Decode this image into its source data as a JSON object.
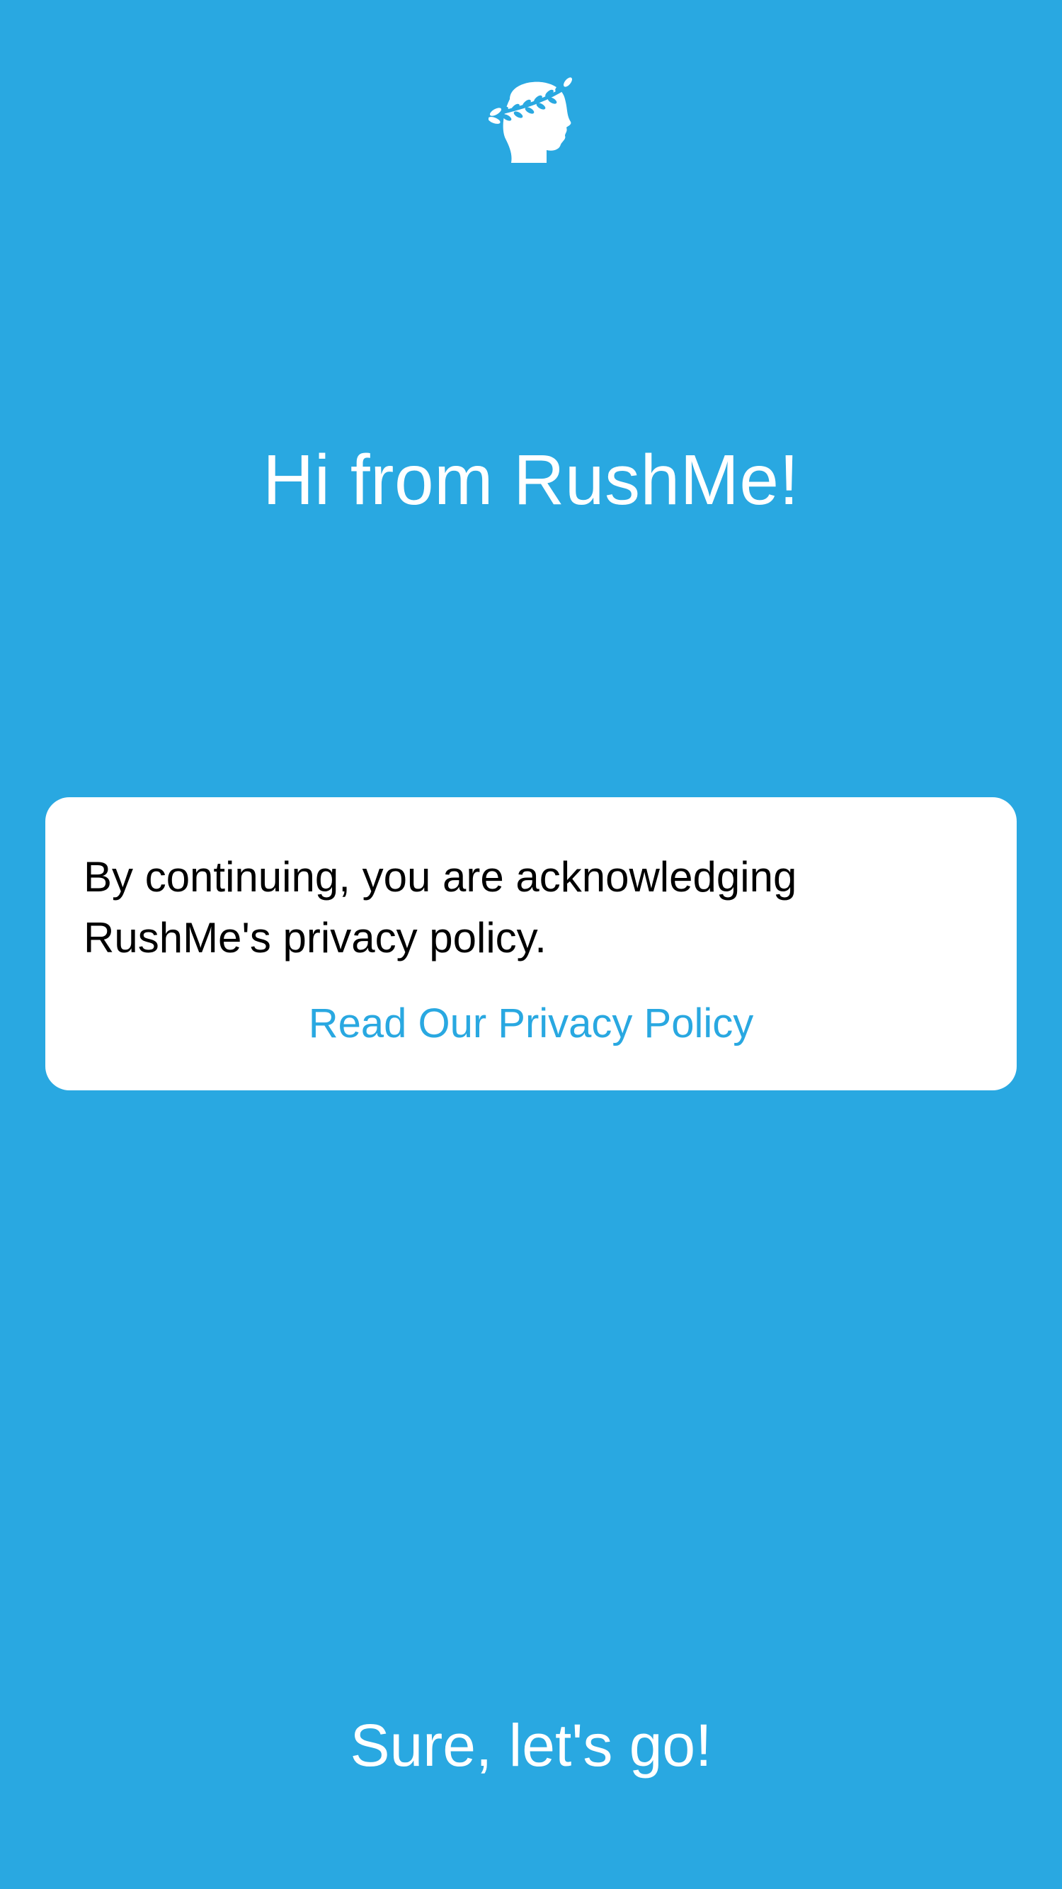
{
  "theme": {
    "background": "#29a8e1",
    "card_background": "#ffffff",
    "link_color": "#29a8e1",
    "text_color": "#000000",
    "on_primary_text": "#ffffff"
  },
  "header": {
    "logo_icon": "laurel-head-icon"
  },
  "main": {
    "greeting": "Hi from RushMe!"
  },
  "privacy_card": {
    "message": "By continuing, you are acknowledging RushMe's privacy policy.",
    "link_label": "Read Our Privacy Policy"
  },
  "footer": {
    "continue_label": "Sure, let's go!"
  }
}
